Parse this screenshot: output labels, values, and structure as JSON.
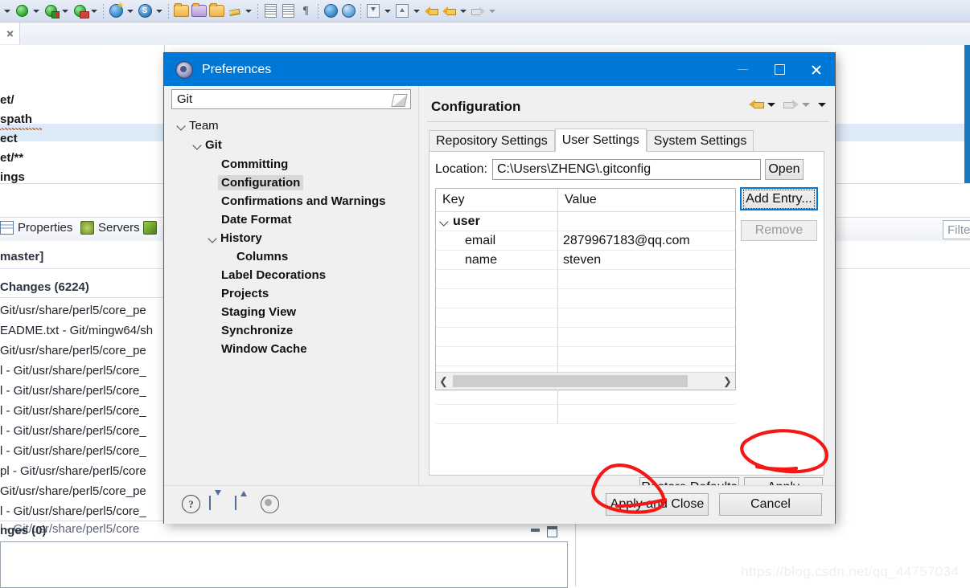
{
  "ide": {
    "toolbar_icons": [
      "run-icon",
      "debug-icon",
      "profile-icon",
      "new-wizard-icon",
      "new-server-icon",
      "open-folder-icon",
      "open-type-icon",
      "open-resource-icon",
      "edit-icon",
      "save-icon",
      "print-icon",
      "paragraph-icon",
      "browser-icon",
      "external-tools-icon",
      "import-icon",
      "export-icon",
      "back-history-icon",
      "back-icon",
      "forward-icon"
    ],
    "editor_tab_close_label": "x",
    "editor_lines": [
      "et/",
      "spath",
      "ect",
      "et/**",
      "ings"
    ],
    "view_tabs": [
      {
        "label": "Properties",
        "icon": "properties-icon"
      },
      {
        "label": "Servers",
        "icon": "servers-icon"
      },
      {
        "label": "",
        "icon": "git-staging-icon"
      }
    ],
    "filter_placeholder": "Filter",
    "git": {
      "repo_header": "master]",
      "unstaged_label": "Changes (6224)",
      "staged_label": "nges (0)",
      "files": [
        "Git/usr/share/perl5/core_pe",
        "EADME.txt - Git/mingw64/sh",
        "Git/usr/share/perl5/core_pe",
        "l - Git/usr/share/perl5/core_",
        "l - Git/usr/share/perl5/core_",
        "l - Git/usr/share/perl5/core_",
        "l - Git/usr/share/perl5/core_",
        "l - Git/usr/share/perl5/core_",
        "pl - Git/usr/share/perl5/core",
        "Git/usr/share/perl5/core_pe",
        "l - Git/usr/share/perl5/core_",
        "l - Git/usr/share/perl5/core"
      ]
    }
  },
  "dialog": {
    "title": "Preferences",
    "window_buttons": {
      "minimize": "minimize-button",
      "maximize": "maximize-button",
      "close": "close-button"
    },
    "filter": {
      "value": "Git",
      "clear_icon": "eraser-icon"
    },
    "tree": [
      {
        "label": "Team",
        "depth": 0,
        "expanded": true,
        "bold": false,
        "selected": false
      },
      {
        "label": "Git",
        "depth": 1,
        "expanded": true,
        "bold": true,
        "selected": false
      },
      {
        "label": "Committing",
        "depth": 2,
        "expanded": null,
        "bold": true,
        "selected": false
      },
      {
        "label": "Configuration",
        "depth": 2,
        "expanded": null,
        "bold": true,
        "selected": true
      },
      {
        "label": "Confirmations and Warnings",
        "depth": 2,
        "expanded": null,
        "bold": true,
        "selected": false
      },
      {
        "label": "Date Format",
        "depth": 2,
        "expanded": null,
        "bold": true,
        "selected": false
      },
      {
        "label": "History",
        "depth": 2,
        "expanded": true,
        "bold": true,
        "selected": false
      },
      {
        "label": "Columns",
        "depth": 3,
        "expanded": null,
        "bold": true,
        "selected": false
      },
      {
        "label": "Label Decorations",
        "depth": 2,
        "expanded": null,
        "bold": true,
        "selected": false
      },
      {
        "label": "Projects",
        "depth": 2,
        "expanded": null,
        "bold": true,
        "selected": false
      },
      {
        "label": "Staging View",
        "depth": 2,
        "expanded": null,
        "bold": true,
        "selected": false
      },
      {
        "label": "Synchronize",
        "depth": 2,
        "expanded": null,
        "bold": true,
        "selected": false
      },
      {
        "label": "Window Cache",
        "depth": 2,
        "expanded": null,
        "bold": true,
        "selected": false
      }
    ],
    "page": {
      "title": "Configuration",
      "nav": {
        "back_icon": "back-arrow-icon",
        "back_menu_icon": "chevron-down-icon",
        "forward_icon": "forward-arrow-icon",
        "forward_menu_icon": "chevron-down-icon",
        "view_menu_icon": "chevron-down-icon"
      },
      "tabs": [
        {
          "label": "Repository Settings",
          "active": false
        },
        {
          "label": "User Settings",
          "active": true
        },
        {
          "label": "System Settings",
          "active": false
        }
      ],
      "location_label": "Location:",
      "location_value": "C:\\Users\\ZHENG\\.gitconfig",
      "open_label": "Open",
      "table": {
        "columns": [
          "Key",
          "Value"
        ],
        "rows": [
          {
            "key": "user",
            "value": "",
            "group": true,
            "expanded": true
          },
          {
            "key": "email",
            "value": "2879967183@qq.com",
            "group": false
          },
          {
            "key": "name",
            "value": "steven",
            "group": false
          }
        ],
        "empty_rows": 8,
        "scroll_left_icon": "chevron-left-icon",
        "scroll_right_icon": "chevron-right-icon"
      },
      "add_entry_label": "Add Entry...",
      "remove_label": "Remove",
      "restore_defaults_label": "Restore Defaults",
      "apply_label": "Apply"
    },
    "footer": {
      "icons": [
        "help-icon",
        "import-icon",
        "export-icon",
        "record-icon"
      ],
      "apply_and_close_label": "Apply and Close",
      "cancel_label": "Cancel"
    }
  },
  "annotations": {
    "color": "#f51616",
    "marks": [
      "circle-around-apply",
      "circle-around-apply-and-close"
    ]
  },
  "watermark": "https://blog.csdn.net/qq_44757034"
}
